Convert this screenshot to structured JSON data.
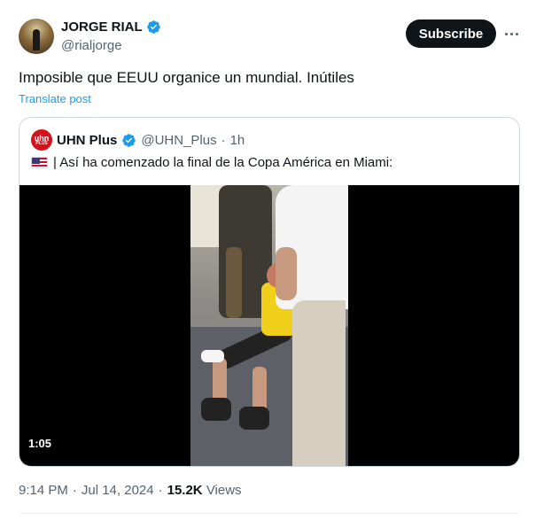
{
  "author": {
    "name": "JORGE RIAL",
    "handle": "@rialjorge",
    "verified": true
  },
  "actions": {
    "subscribe_label": "Subscribe",
    "more_icon": "more-horizontal-icon"
  },
  "tweet": {
    "text": "Imposible que EEUU organice un mundial. Inútiles",
    "translate_label": "Translate post"
  },
  "quoted": {
    "logo_text": "uhn",
    "logo_subtext": "PLUS",
    "name": "UHN Plus",
    "handle": "@UHN_Plus",
    "separator": "·",
    "time": "1h",
    "text": "| Así ha comenzado la final de la Copa América en Miami:",
    "flag_icon": "us-flag-icon",
    "video": {
      "duration": "1:05"
    }
  },
  "meta": {
    "time": "9:14 PM",
    "separator1": "·",
    "date": "Jul 14, 2024",
    "separator2": "·",
    "views_count": "15.2K",
    "views_label": "Views"
  },
  "colors": {
    "verified_blue": "#1d9bf0",
    "link_blue": "#1d9bf0",
    "text_primary": "#0f1419",
    "text_secondary": "#536471",
    "border": "#cfd9de",
    "uhn_red": "#d5121a"
  }
}
